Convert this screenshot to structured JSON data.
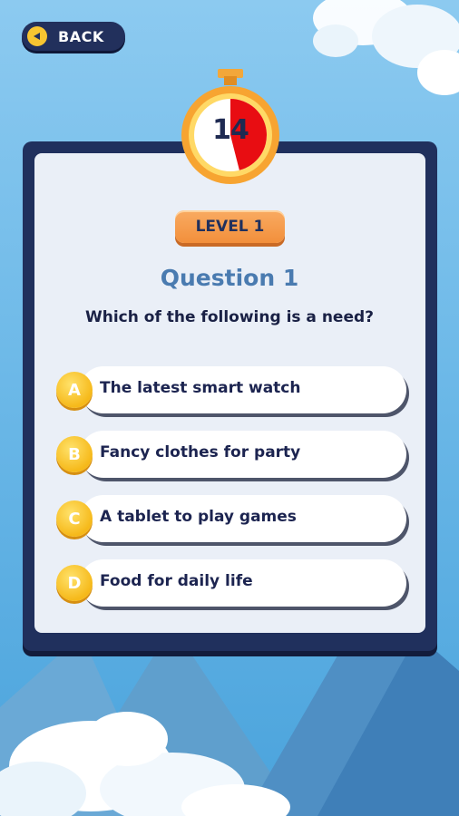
{
  "header": {
    "back_label": "BACK"
  },
  "timer": {
    "seconds": "14",
    "remaining_fraction": 0.6
  },
  "level": {
    "label": "LEVEL 1"
  },
  "question": {
    "title": "Question 1",
    "text": "Which of the following is a need?"
  },
  "options": [
    {
      "letter": "A",
      "text": "The latest smart watch"
    },
    {
      "letter": "B",
      "text": "Fancy clothes for party"
    },
    {
      "letter": "C",
      "text": "A tablet to play games"
    },
    {
      "letter": "D",
      "text": "Food for daily life"
    }
  ],
  "colors": {
    "panel": "#20305d",
    "panel_inner": "#eaeff7",
    "badge": "#f6b91a",
    "timer_red": "#e80d12",
    "level_orange": "#f28f3b",
    "question_title": "#4a7bb0"
  },
  "icons": {
    "back": "left-triangle-icon"
  }
}
